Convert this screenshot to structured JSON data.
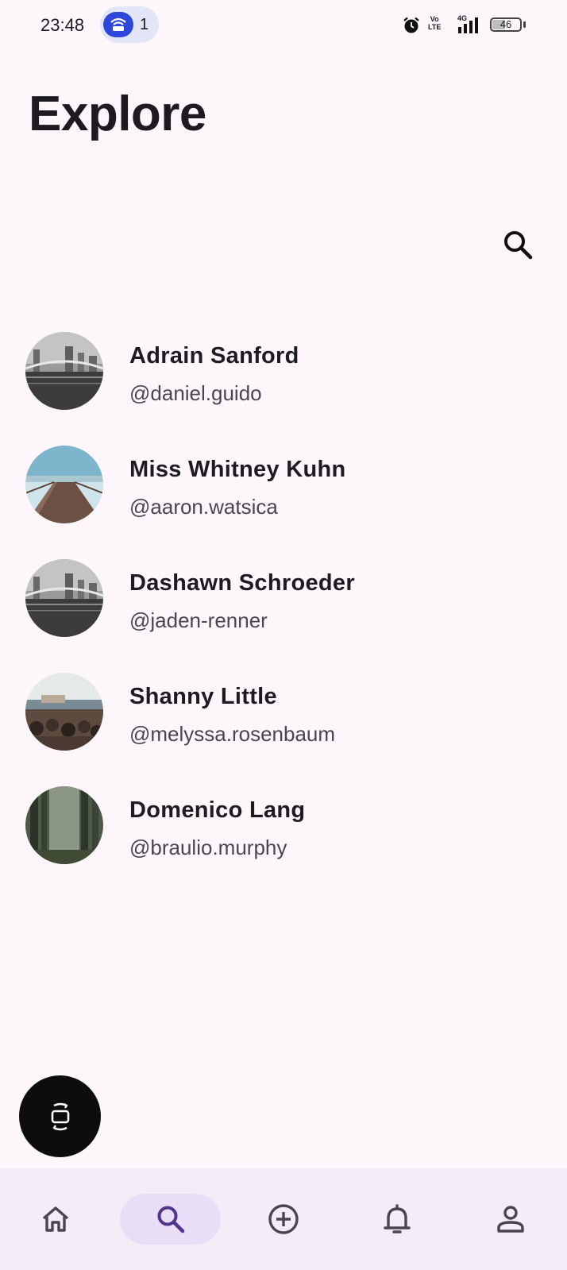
{
  "status_bar": {
    "time": "23:48",
    "hotspot_count": "1",
    "volte_line1": "Vo",
    "volte_line2": "LTE",
    "network": "4G",
    "battery": "46"
  },
  "header": {
    "title": "Explore"
  },
  "users": [
    {
      "name": "Adrain Sanford",
      "handle": "@daniel.guido",
      "avatar": "city-bridge-bw"
    },
    {
      "name": "Miss Whitney Kuhn",
      "handle": "@aaron.watsica",
      "avatar": "pier-sea"
    },
    {
      "name": "Dashawn Schroeder",
      "handle": "@jaden-renner",
      "avatar": "city-bridge-bw"
    },
    {
      "name": "Shanny Little",
      "handle": "@melyssa.rosenbaum",
      "avatar": "crowd-harbor"
    },
    {
      "name": "Domenico Lang",
      "handle": "@braulio.murphy",
      "avatar": "forest"
    }
  ],
  "bottom_nav": {
    "items": [
      "home-icon",
      "search-icon",
      "add-circle-icon",
      "bell-icon",
      "person-icon"
    ],
    "active": "search-icon"
  },
  "colors": {
    "background": "#fdf7fc",
    "nav_background": "#f3edf7",
    "nav_active_indicator": "#e8def8",
    "fab": "#0d0d0d"
  }
}
